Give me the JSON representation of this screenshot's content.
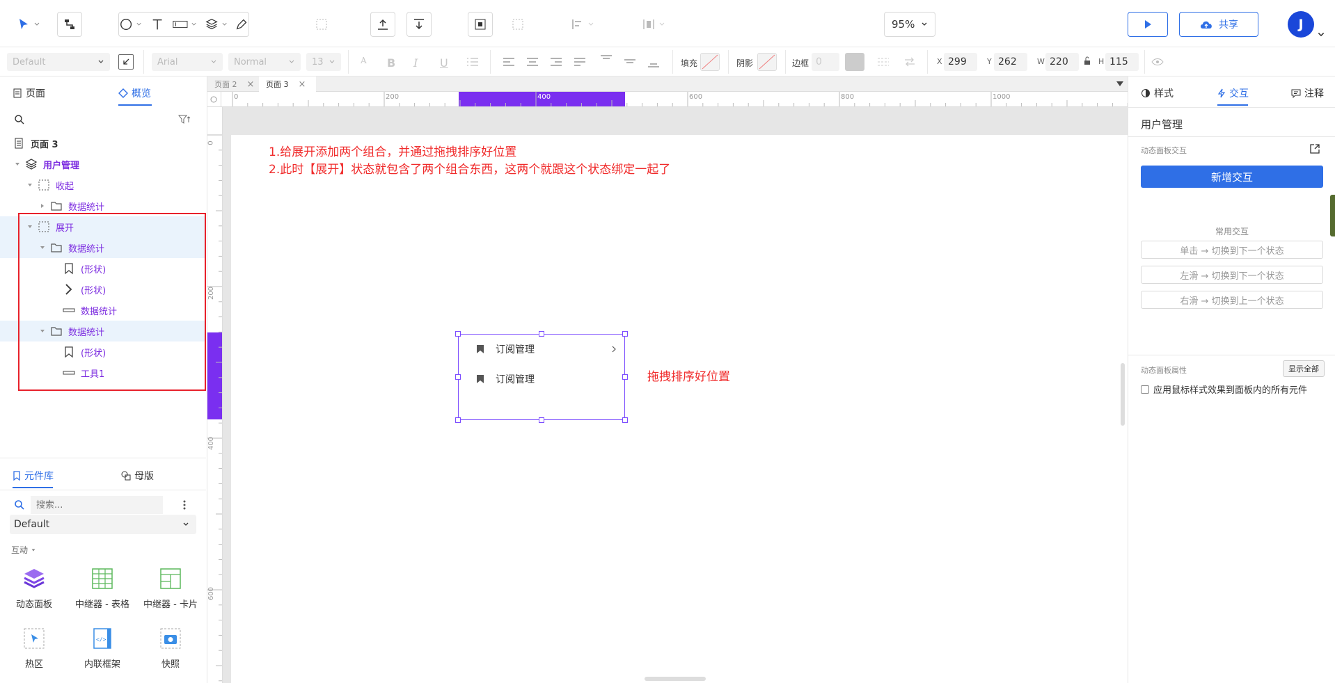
{
  "toolbar": {
    "zoom": "95%",
    "share_label": "共享",
    "avatar_initial": "J"
  },
  "formatbar": {
    "style_select": "Default",
    "font_select": "Arial",
    "weight_select": "Normal",
    "size_select": "13",
    "fill_label": "填充",
    "shadow_label": "阴影",
    "border_label": "边框",
    "border_value": "0",
    "x_label": "X",
    "x_value": "299",
    "y_label": "Y",
    "y_value": "262",
    "w_label": "W",
    "w_value": "220",
    "h_label": "H",
    "h_value": "115"
  },
  "leftpanel": {
    "tab_pages": "页面",
    "tab_outline": "概览",
    "tree": [
      {
        "label": "页面 3"
      },
      {
        "label": "用户管理"
      },
      {
        "label": "收起"
      },
      {
        "label": "数据统计"
      },
      {
        "label": "展开"
      },
      {
        "label": "数据统计"
      },
      {
        "label": "(形状)"
      },
      {
        "label": "(形状)"
      },
      {
        "label": "数据统计"
      },
      {
        "label": "数据统计"
      },
      {
        "label": "(形状)"
      },
      {
        "label": "工具1"
      }
    ],
    "tab_library": "元件库",
    "tab_masters": "母版",
    "search_placeholder": "搜索...",
    "library_select": "Default",
    "category": "互动",
    "widgets": [
      {
        "label": "动态面板"
      },
      {
        "label": "中继器 - 表格"
      },
      {
        "label": "中继器 - 卡片"
      },
      {
        "label": "热区"
      },
      {
        "label": "内联框架"
      },
      {
        "label": "快照"
      }
    ]
  },
  "canvas": {
    "page_tabs": [
      {
        "label": "页面 2"
      },
      {
        "label": "页面 3"
      }
    ],
    "ruler_h": [
      "0",
      "200",
      "400",
      "600",
      "800",
      "1000"
    ],
    "ruler_v": [
      "0",
      "200",
      "400",
      "600"
    ],
    "annotation_line1": "1.给展开添加两个组合，并通过拖拽排序好位置",
    "annotation_line2": "2.此时【展开】状态就包含了两个组合东西，这两个就跟这个状态绑定一起了",
    "annotation_side": "拖拽排序好位置",
    "menu_item_1": "订阅管理",
    "menu_item_2": "订阅管理"
  },
  "rightpanel": {
    "tab_style": "样式",
    "tab_interact": "交互",
    "tab_notes": "注释",
    "title": "用户管理",
    "section_interactions": "动态面板交互",
    "add_interaction": "新增交互",
    "common_title": "常用交互",
    "common": [
      {
        "label": "单击 → 切换到下一个状态"
      },
      {
        "label": "左滑 → 切换到下一个状态"
      },
      {
        "label": "右滑 → 切换到上一个状态"
      }
    ],
    "section_props": "动态面板属性",
    "show_all": "显示全部",
    "checkbox_label": "应用鼠标样式效果到面板内的所有元件"
  },
  "colors": {
    "accent_blue": "#2f6fe6",
    "selection_purple": "#7c2ce0",
    "annotation_red": "#f02b2b"
  }
}
